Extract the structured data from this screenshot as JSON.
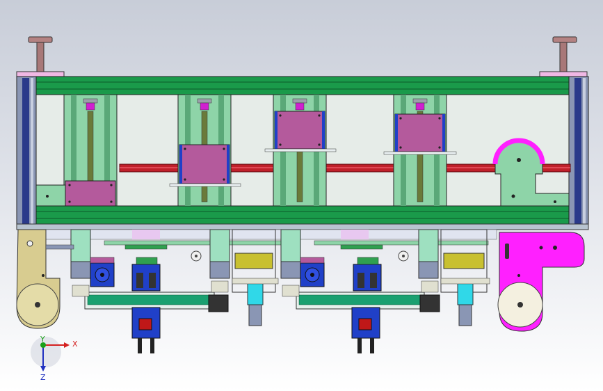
{
  "viewport": {
    "background_top": "#c8cdd8",
    "background_bottom": "#ffffff"
  },
  "triad": {
    "x_label": "X",
    "y_label": "Y",
    "z_label": "Z",
    "x_color": "#d42020",
    "y_color": "#1aa01a",
    "z_color": "#2030c0"
  },
  "palette": {
    "frame_green": "#1a9a4a",
    "panel_green": "#8ed4a8",
    "carriage_magenta": "#b45a9c",
    "rod_red": "#c0202a",
    "motor_blue": "#2040c8",
    "wheel_khaki": "#d8cc90",
    "bracket_magenta": "#ff20ff",
    "column_gray": "#8a96b4",
    "cylinder_cyan": "#30d8e8"
  }
}
